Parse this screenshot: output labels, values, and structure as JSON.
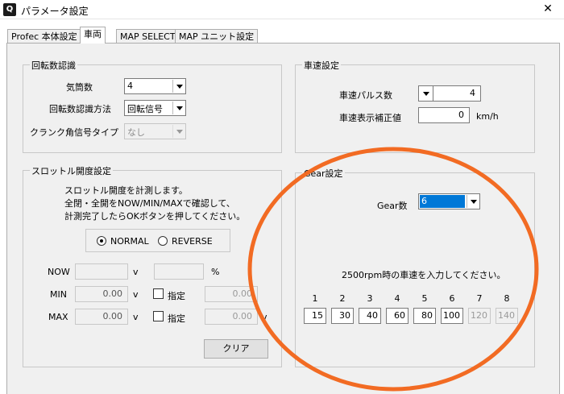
{
  "window": {
    "title": "パラメータ設定",
    "app_icon": "Q",
    "close_glyph": "✕"
  },
  "tabs": [
    {
      "label": "Profec 本体設定",
      "active": false
    },
    {
      "label": "車両",
      "active": true
    },
    {
      "label": "MAP SELECT",
      "active": false
    },
    {
      "label": "MAP ユニット設定",
      "active": false
    }
  ],
  "rpm": {
    "title": "回転数認識",
    "cylinders_label": "気筒数",
    "cylinders_value": "4",
    "method_label": "回転数認識方法",
    "method_value": "回転信号",
    "crank_label": "クランク角信号タイプ",
    "crank_value": "なし"
  },
  "speed": {
    "title": "車速設定",
    "pulse_label": "車速パルス数",
    "pulse_value": "4",
    "correction_label": "車速表示補正値",
    "correction_value": "0",
    "correction_unit": "km/h"
  },
  "throttle": {
    "title": "スロットル開度設定",
    "instructions": [
      "スロットル開度を計測します。",
      "全閉・全開をNOW/MIN/MAXで確認して、",
      "計測完了したらOKボタンを押してください。"
    ],
    "normal_label": "NORMAL",
    "reverse_label": "REVERSE",
    "now_label": "NOW",
    "min_label": "MIN",
    "max_label": "MAX",
    "v_unit": "v",
    "pct_unit": "%",
    "now_value": "",
    "now_pct": "",
    "min_value": "0.00",
    "max_value": "0.00",
    "specify_label": "指定",
    "min_specify_value": "0.00",
    "max_specify_value": "0.00",
    "max_specify_unit": "v",
    "clear_label": "クリア"
  },
  "gear": {
    "title": "Gear設定",
    "count_label": "Gear数",
    "count_value": "6",
    "instruction": "2500rpm時の車速を入力してください。",
    "numbers": [
      "1",
      "2",
      "3",
      "4",
      "5",
      "6",
      "7",
      "8"
    ],
    "values": [
      "15",
      "30",
      "40",
      "60",
      "80",
      "100",
      "120",
      "140"
    ],
    "enabled_count": 6
  },
  "annotation": {
    "ellipse_color": "#f26b23"
  }
}
